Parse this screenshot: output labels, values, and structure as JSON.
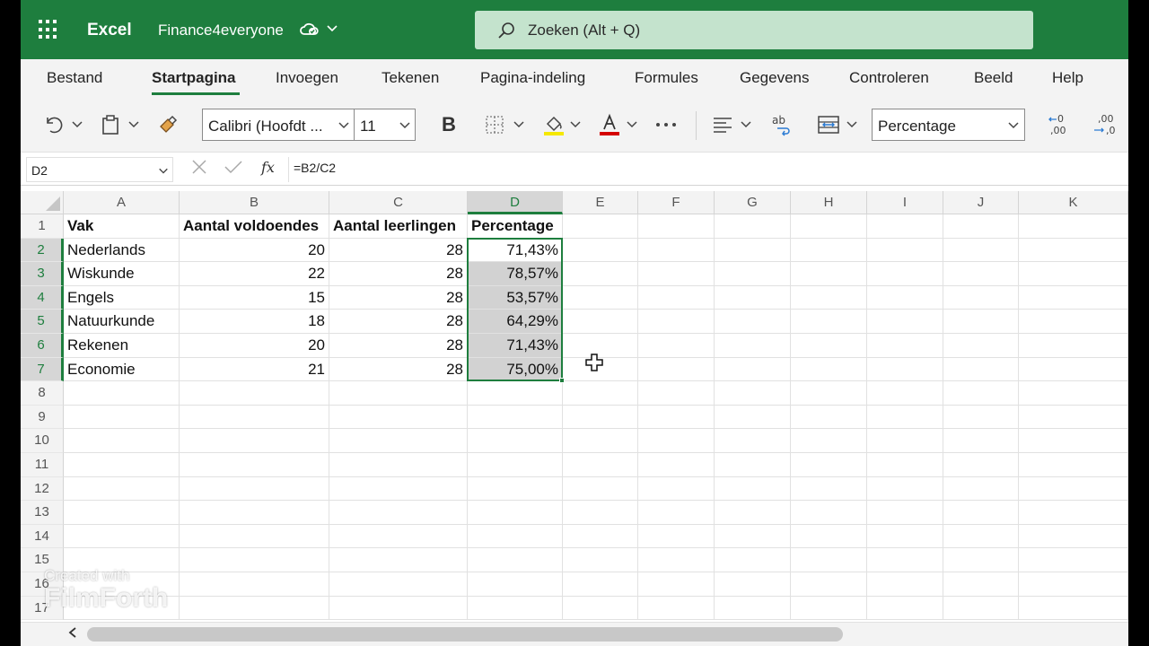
{
  "titlebar": {
    "app_name": "Excel",
    "doc_name": "Finance4everyone",
    "search_placeholder": "Zoeken (Alt + Q)"
  },
  "ribbon": {
    "tabs": [
      {
        "label": "Bestand"
      },
      {
        "label": "Startpagina",
        "active": true
      },
      {
        "label": "Invoegen"
      },
      {
        "label": "Tekenen"
      },
      {
        "label": "Pagina-indeling"
      },
      {
        "label": "Formules"
      },
      {
        "label": "Gegevens"
      },
      {
        "label": "Controleren"
      },
      {
        "label": "Beeld"
      },
      {
        "label": "Help"
      }
    ],
    "font_name": "Calibri (Hoofdt ...",
    "font_size": "11",
    "bold_label": "B",
    "number_format": "Percentage",
    "fill_color": "#f5e800",
    "font_color": "#d40000"
  },
  "formula_bar": {
    "name_box": "D2",
    "fx_label": "fx",
    "formula": "=B2/C2"
  },
  "sheet": {
    "columns": [
      "A",
      "B",
      "C",
      "D",
      "E",
      "F",
      "G",
      "H",
      "I",
      "J",
      "K"
    ],
    "selected_column": "D",
    "row_numbers": [
      "1",
      "2",
      "3",
      "4",
      "5",
      "6",
      "7",
      "8",
      "9",
      "10",
      "11",
      "12",
      "13",
      "14",
      "15",
      "16",
      "17"
    ],
    "header_row": [
      "Vak",
      "Aantal voldoendes",
      "Aantal leerlingen",
      "Percentage"
    ],
    "data_rows": [
      [
        "Nederlands",
        "20",
        "28",
        "71,43%"
      ],
      [
        "Wiskunde",
        "22",
        "28",
        "78,57%"
      ],
      [
        "Engels",
        "15",
        "28",
        "53,57%"
      ],
      [
        "Natuurkunde",
        "18",
        "28",
        "64,29%"
      ],
      [
        "Rekenen",
        "20",
        "28",
        "71,43%"
      ],
      [
        "Economie",
        "21",
        "28",
        "75,00%"
      ]
    ],
    "selection": "D2:D7",
    "accent_color": "#1e7e3e"
  },
  "watermark": {
    "line1": "Created with",
    "line2": "FilmForth"
  }
}
